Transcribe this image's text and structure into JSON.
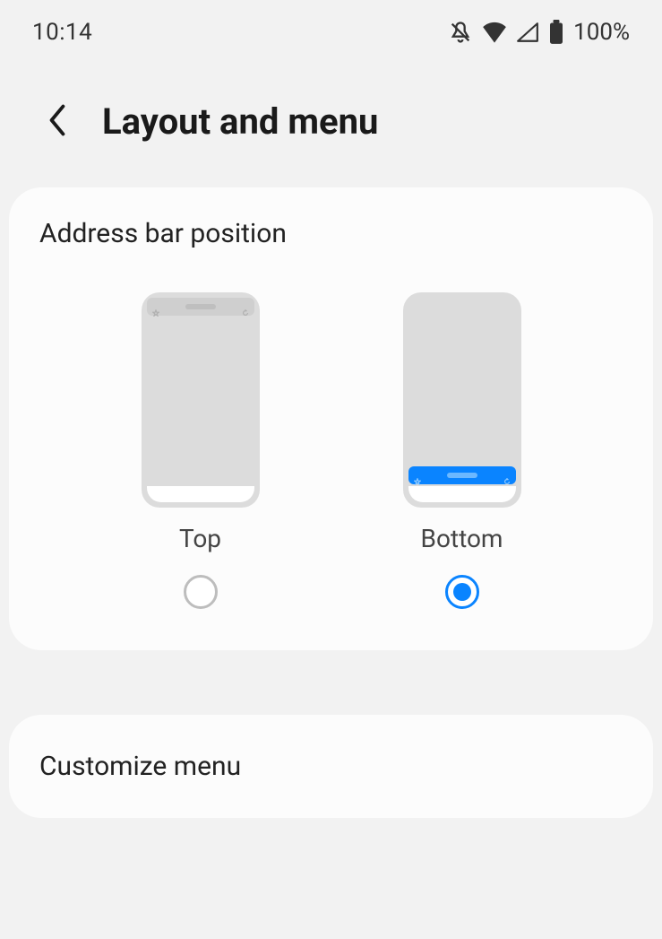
{
  "status": {
    "time": "10:14",
    "battery": "100%",
    "icons": [
      "mute",
      "wifi",
      "cell",
      "battery"
    ]
  },
  "header": {
    "title": "Layout and menu"
  },
  "address_bar_section": {
    "title": "Address bar position",
    "options": [
      {
        "label": "Top",
        "selected": false
      },
      {
        "label": "Bottom",
        "selected": true
      }
    ]
  },
  "customize_menu": {
    "label": "Customize menu"
  },
  "colors": {
    "accent": "#0a84ff"
  }
}
